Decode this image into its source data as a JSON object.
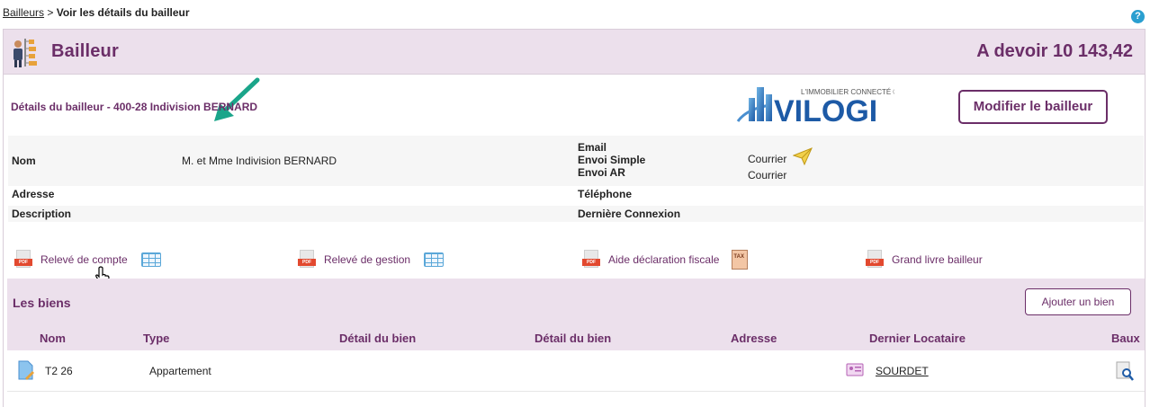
{
  "breadcrumb": {
    "parent": "Bailleurs",
    "separator": " > ",
    "current": "Voir les détails du bailleur"
  },
  "help": {
    "glyph": "?"
  },
  "header": {
    "title": "Bailleur",
    "amount_due": "A devoir 10 143,42"
  },
  "details": {
    "subtitle": "Détails du bailleur - 400-28 Indivision BERNARD",
    "logo_tagline": "L'IMMOBILIER CONNECTÉ ®",
    "logo_text": "VILOGI",
    "edit_button": "Modifier le bailleur"
  },
  "info": {
    "nom_label": "Nom",
    "nom_value": "M. et Mme Indivision BERNARD",
    "adresse_label": "Adresse",
    "description_label": "Description",
    "email_label": "Email",
    "envoi_simple_label": "Envoi Simple",
    "envoi_simple_value": "Courrier",
    "envoi_ar_label": "Envoi AR",
    "envoi_ar_value": "Courrier",
    "telephone_label": "Téléphone",
    "derniere_connexion_label": "Dernière Connexion"
  },
  "documents": [
    {
      "label": "Relevé de compte",
      "pdf_tag": "PDF"
    },
    {
      "label": "Relevé de gestion",
      "pdf_tag": "PDF"
    },
    {
      "label": "Aide déclaration fiscale",
      "pdf_tag": "PDF",
      "tax_tag": "TAX"
    },
    {
      "label": "Grand livre bailleur",
      "pdf_tag": "PDF"
    }
  ],
  "biens": {
    "title": "Les biens",
    "add_button": "Ajouter un bien",
    "columns": [
      "Nom",
      "Type",
      "Détail du bien",
      "Détail du bien",
      "Adresse",
      "Dernier Locataire",
      "Baux"
    ],
    "rows": [
      {
        "nom": "T2 26",
        "type": "Appartement",
        "dernier_locataire": "SOURDET"
      }
    ]
  },
  "colors": {
    "accent": "#6b2e68",
    "header_bg": "#ece0ec",
    "arrow": "#1aa58a"
  }
}
